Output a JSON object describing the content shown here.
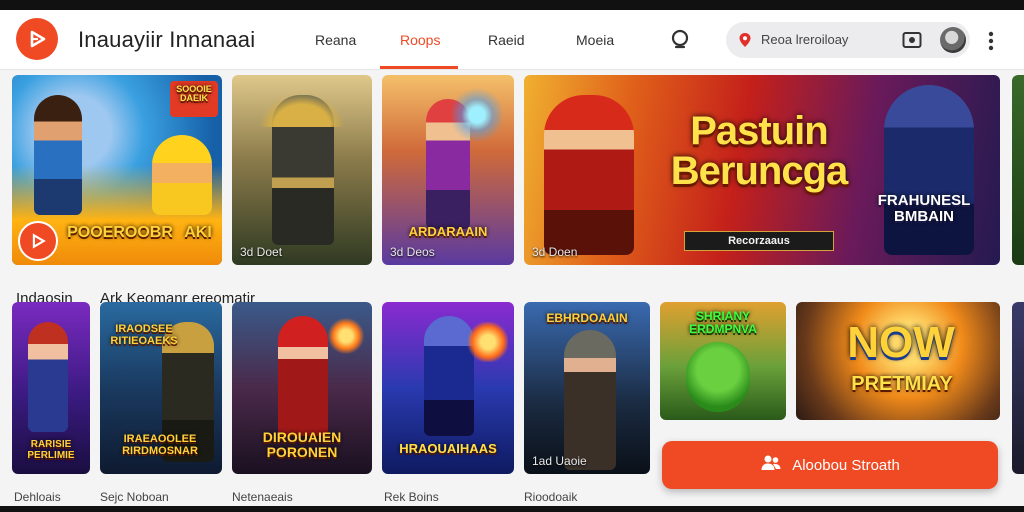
{
  "header": {
    "app_title": "Inauayiir Innanaai",
    "tabs": [
      {
        "label": "Reana"
      },
      {
        "label": "Roops"
      },
      {
        "label": "Raeid"
      },
      {
        "label": "Moeia"
      }
    ],
    "active_tab": "Roops",
    "search_text": "Reoa lreroiloay"
  },
  "row1": {
    "cards": [
      {
        "badge": "Soooie Daeik",
        "tag": "Pooeroobr",
        "tag2": "Aki"
      },
      {
        "caption": "3d Doet"
      },
      {
        "tag": "Ardaraain",
        "caption": "3d Deos"
      },
      {
        "headline": "Pastuin Beruncga",
        "subtitle": "Recorzaaus",
        "side_tag": "Frahunesl Bmbain",
        "caption": "3d Doen"
      }
    ]
  },
  "row2": {
    "titles": [
      "Indaosin",
      "Ark Keomanr ereomatir"
    ],
    "cards": [
      {
        "tag": "Rarisie Perlimie"
      },
      {
        "tag_top": "Iraodsee Ritieoaeks",
        "tag_bottom": "Iraeaoolee Rirdmosnar"
      },
      {
        "tag": "Dirouaien Poronen"
      },
      {
        "tag": "Hraouaihaas"
      },
      {
        "tag_top": "Ebhrdoaain",
        "caption": "1ad Uaoie"
      },
      {
        "tag": "Shriany Erdmpnva"
      },
      {
        "tag_top": "Now",
        "tag_bottom": "Pretmiay"
      }
    ],
    "labels": [
      "Dehloais",
      "Sejc Noboan",
      "Netenaeais",
      "Rek Boins",
      "Rioodoaik"
    ]
  },
  "cta": {
    "label": "Aloobou Stroath"
  },
  "colors": {
    "accent": "#ef4a23"
  }
}
